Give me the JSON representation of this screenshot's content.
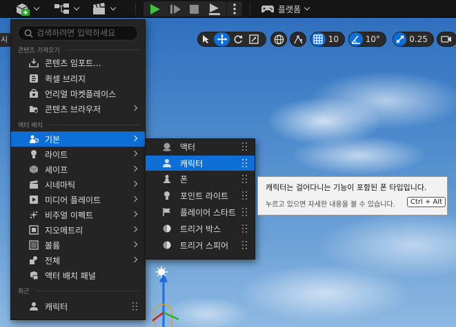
{
  "toolbar": {
    "platform_label": "플랫폼",
    "icons": [
      "add-actor-icon",
      "blueprint-icon",
      "cinematics-icon",
      "play-icon",
      "step-icon",
      "stop-icon",
      "eject-icon",
      "more-options-icon",
      "platform-gamepad-icon"
    ]
  },
  "viewport": {
    "left_tab_label": "시",
    "grid_snap_value": "10",
    "rotation_snap_value": "10°",
    "scale_snap_value": "0.25",
    "accent_color": "#0d6fd6"
  },
  "menu": {
    "search_placeholder": "검색하려면 입력하세요",
    "sections": {
      "import": "콘텐츠 가져오기",
      "placement": "액터 배치",
      "recent": "최근"
    },
    "import_items": [
      {
        "label": "콘텐츠 임포트...",
        "icon": "import-icon"
      },
      {
        "label": "퀵셀 브리지",
        "icon": "bridge-icon"
      },
      {
        "label": "언리얼 마켓플레이스",
        "icon": "marketplace-icon"
      },
      {
        "label": "콘텐츠 브라우저",
        "icon": "content-browser-icon"
      }
    ],
    "placement_items": [
      {
        "label": "기본",
        "icon": "basic-icon"
      },
      {
        "label": "라이트",
        "icon": "light-icon"
      },
      {
        "label": "셰이프",
        "icon": "shape-icon"
      },
      {
        "label": "시네마틱",
        "icon": "cinematic-icon"
      },
      {
        "label": "미디어 플레이트",
        "icon": "media-plate-icon"
      },
      {
        "label": "비주얼 이펙트",
        "icon": "visual-effects-icon"
      },
      {
        "label": "지오메트리",
        "icon": "geometry-icon"
      },
      {
        "label": "볼륨",
        "icon": "volume-icon"
      },
      {
        "label": "전체",
        "icon": "all-classes-icon"
      },
      {
        "label": "액터 배치 패널",
        "icon": "place-actors-panel-icon"
      }
    ],
    "recent_items": [
      {
        "label": "캐릭터",
        "icon": "character-icon"
      }
    ]
  },
  "submenu": {
    "items": [
      {
        "label": "액터",
        "icon": "actor-icon"
      },
      {
        "label": "캐릭터",
        "icon": "character-icon"
      },
      {
        "label": "폰",
        "icon": "pawn-icon"
      },
      {
        "label": "포인트 라이트",
        "icon": "point-light-icon"
      },
      {
        "label": "플레이어 스타트",
        "icon": "player-start-icon"
      },
      {
        "label": "트리거 박스",
        "icon": "trigger-box-icon"
      },
      {
        "label": "트리거 스피어",
        "icon": "trigger-sphere-icon"
      }
    ]
  },
  "tooltip": {
    "description": "캐릭터는 걸어다니는 기능이 포함된 폰 타입입니다.",
    "hint": "누르고 있으면 자세한 내용을 볼 수 있습니다.",
    "shortcut": "Ctrl + Alt"
  }
}
